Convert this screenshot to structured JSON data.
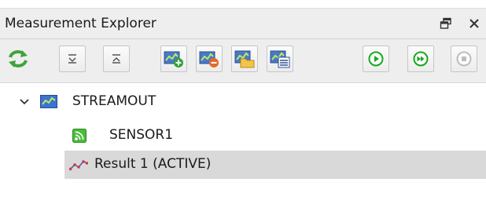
{
  "panel": {
    "title": "Measurement Explorer"
  },
  "toolbar": {
    "buttons": [
      {
        "icon": "refresh-icon"
      },
      {
        "icon": "collapse-down-icon"
      },
      {
        "icon": "expand-up-icon"
      },
      {
        "icon": "add-measurement-icon"
      },
      {
        "icon": "remove-measurement-icon"
      },
      {
        "icon": "open-measurement-icon"
      },
      {
        "icon": "measurement-properties-icon"
      },
      {
        "icon": "play-icon"
      },
      {
        "icon": "fast-forward-icon"
      },
      {
        "icon": "stop-icon"
      }
    ]
  },
  "tree": {
    "root": {
      "label": "STREAMOUT",
      "expanded": true,
      "icon": "measurement-icon"
    },
    "children": [
      {
        "label": "SENSOR1",
        "icon": "sensor-icon",
        "selected": false
      },
      {
        "label": "Result 1 (ACTIVE)",
        "icon": "result-icon",
        "selected": true
      }
    ]
  },
  "colors": {
    "play_green": "#16a81e",
    "selection": "#d9d9d9",
    "sensor_green": "#4cbb3c",
    "result_red": "#d23a3a",
    "result_blue": "#3a62d8"
  }
}
